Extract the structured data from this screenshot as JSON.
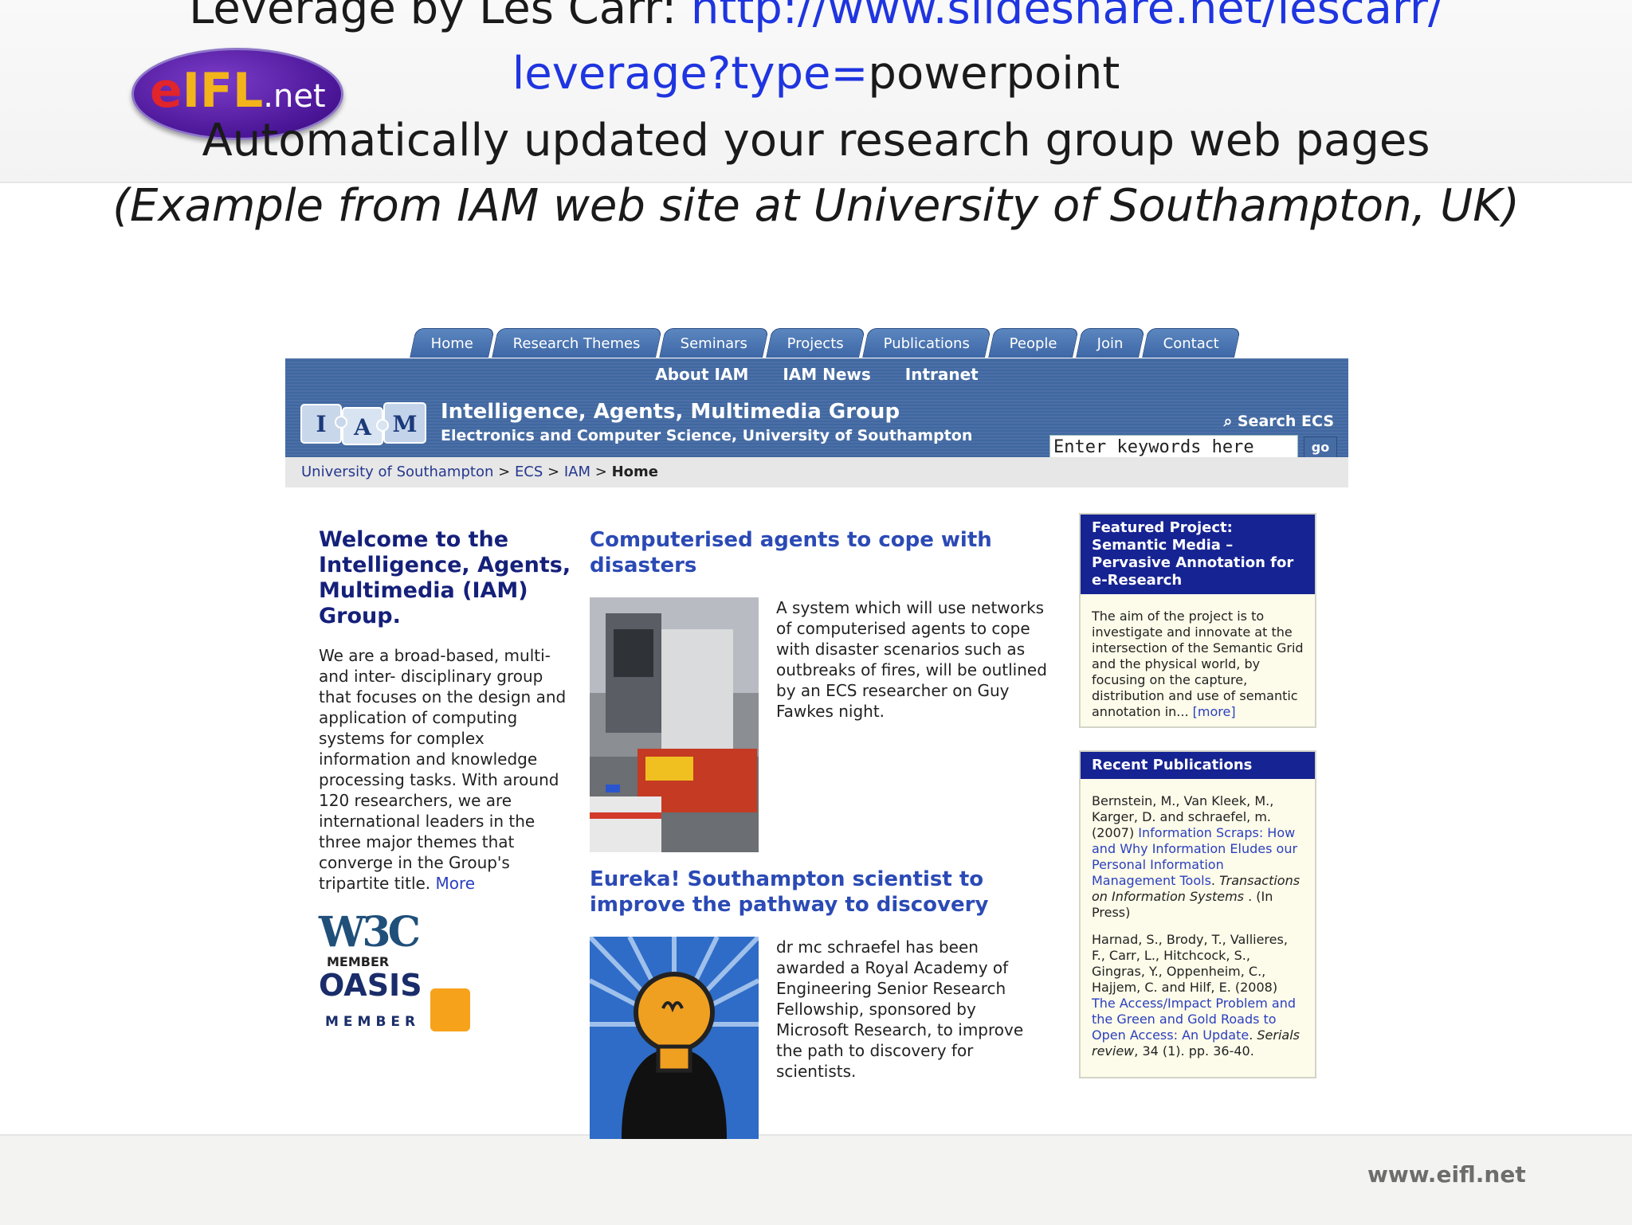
{
  "slide": {
    "line1_prefix": "Leverage by Les Carr: ",
    "line1_link": "http://www.slideshare.net/lescarr/",
    "line2_link": "leverage?type=",
    "line2_suffix": "powerpoint",
    "line3": "Automatically updated your research group web pages",
    "line4": "(Example from IAM web site at University of Southampton, UK)",
    "logo_e": "e",
    "logo_ifl": "IFL",
    "logo_net": ".net",
    "footer_url": "www.eifl.net"
  },
  "site": {
    "tabs": [
      "Home",
      "Research Themes",
      "Seminars",
      "Projects",
      "Publications",
      "People",
      "Join",
      "Contact"
    ],
    "subnav": [
      "About IAM",
      "IAM News",
      "Intranet"
    ],
    "puzzle_letters": [
      "I",
      "A",
      "M"
    ],
    "group_title": "Intelligence, Agents, Multimedia Group",
    "group_subtitle": "Electronics and Computer Science, University of Southampton",
    "search_label": "Search ECS",
    "search_value": "Enter keywords here",
    "search_go": "go",
    "breadcrumb": [
      "University of Southampton",
      "ECS",
      "IAM",
      "Home"
    ],
    "breadcrumb_sep": ">",
    "welcome_heading": "Welcome to the Intelligence, Agents, Multimedia (IAM) Group.",
    "welcome_text": "We are a broad-based, multi- and inter- disciplinary group that focuses on the design and application of computing systems for complex information and knowledge processing tasks. With around 120 researchers, we are international leaders in the three major themes that converge in the Group's tripartite title.",
    "welcome_more": "More",
    "w3c_logo": "W3C",
    "w3c_member": "MEMBER",
    "oasis_logo": "OASIS",
    "oasis_member": "MEMBER",
    "news": [
      {
        "title": "Computerised agents to cope with disasters",
        "text": "A system which will use networks of computerised agents to cope with disaster scenarios such as outbreaks of fires, will be outlined by an ECS researcher on Guy Fawkes night."
      },
      {
        "title": "Eureka! Southampton scientist to improve the pathway to discovery",
        "text": "dr mc schraefel has been awarded a Royal Academy of Engineering Senior Research Fellowship, sponsored by Microsoft Research, to improve the path to discovery for scientists."
      }
    ],
    "featured": {
      "heading": "Featured Project: Semantic Media – Pervasive Annotation for e-Research",
      "text": "The aim of the project is to investigate and innovate at the intersection of the Semantic Grid and the physical world, by focusing on the capture, distribution and use of semantic annotation in...",
      "more": "[more]"
    },
    "publications": {
      "heading": "Recent Publications",
      "items": [
        {
          "authors": "Bernstein, M., Van Kleek, M., Karger, D. and schraefel, m. (2007) ",
          "title": "Information Scraps: How and Why Information Eludes our Personal Information Management Tools",
          "venue": "Transactions on Information Systems",
          "tail": " . (In Press)"
        },
        {
          "authors": "Harnad, S., Brody, T., Vallieres, F., Carr, L., Hitchcock, S., Gingras, Y., Oppenheim, C., Hajjem, C. and Hilf, E. (2008) ",
          "title": "The Access/Impact Problem and the Green and Gold Roads to Open Access: An Update",
          "venue": "Serials review",
          "tail": ", 34 (1). pp. 36-40."
        }
      ]
    }
  }
}
